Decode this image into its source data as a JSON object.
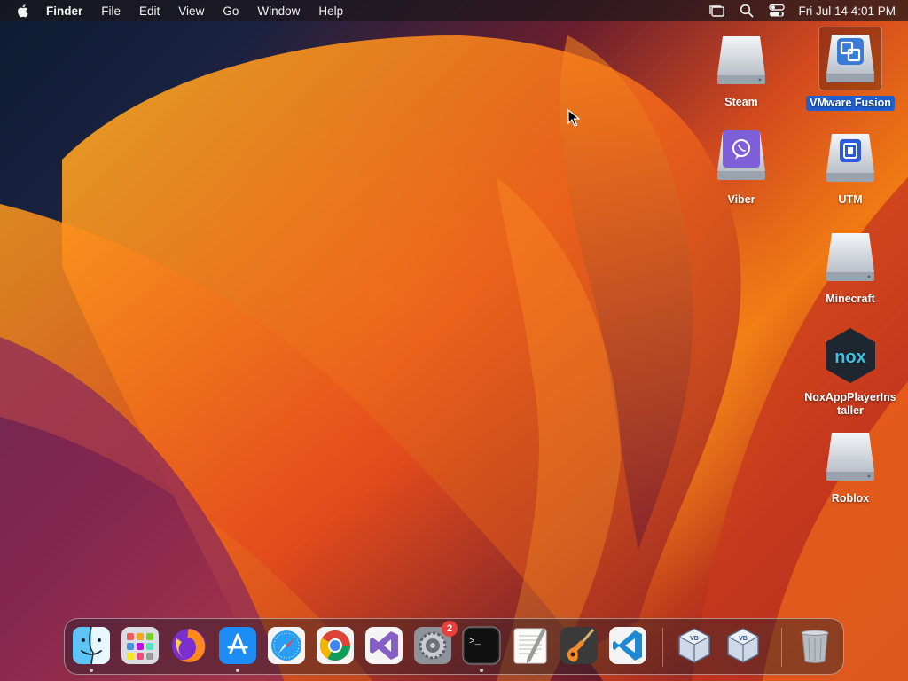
{
  "menubar": {
    "app_name": "Finder",
    "items": [
      "File",
      "Edit",
      "View",
      "Go",
      "Window",
      "Help"
    ],
    "clock": "Fri Jul 14  4:01 PM"
  },
  "desktop": {
    "icons": [
      {
        "label": "Steam",
        "icon": "drive-icon"
      },
      {
        "label": "VMware Fusion",
        "icon": "vmware-drive-icon",
        "selected": true
      },
      {
        "label": "Viber",
        "icon": "viber-drive-icon"
      },
      {
        "label": "UTM",
        "icon": "utm-drive-icon"
      },
      {
        "label": "Minecraft",
        "icon": "drive-icon"
      },
      {
        "label": "NoxAppPlayerInstaller",
        "icon": "nox-icon",
        "logo_text": "nox"
      },
      {
        "label": "Roblox",
        "icon": "drive-icon"
      }
    ],
    "selection_color": "#1f5fd1"
  },
  "dock": {
    "items": [
      {
        "name": "finder",
        "running": true
      },
      {
        "name": "launchpad",
        "running": false
      },
      {
        "name": "firefox",
        "running": false
      },
      {
        "name": "app-store",
        "running": true
      },
      {
        "name": "safari",
        "running": false
      },
      {
        "name": "chrome",
        "running": false
      },
      {
        "name": "visual-studio",
        "running": false
      },
      {
        "name": "system-settings",
        "running": false,
        "badge": "2"
      },
      {
        "name": "terminal",
        "running": true
      },
      {
        "name": "textedit",
        "running": false
      },
      {
        "name": "garageband",
        "running": false
      },
      {
        "name": "vscode",
        "running": false
      },
      {
        "name": "virtualbox",
        "running": false
      },
      {
        "name": "virtualbox-vm",
        "running": false
      },
      {
        "name": "trash",
        "running": false
      }
    ],
    "terminal_prompt": ">_"
  }
}
